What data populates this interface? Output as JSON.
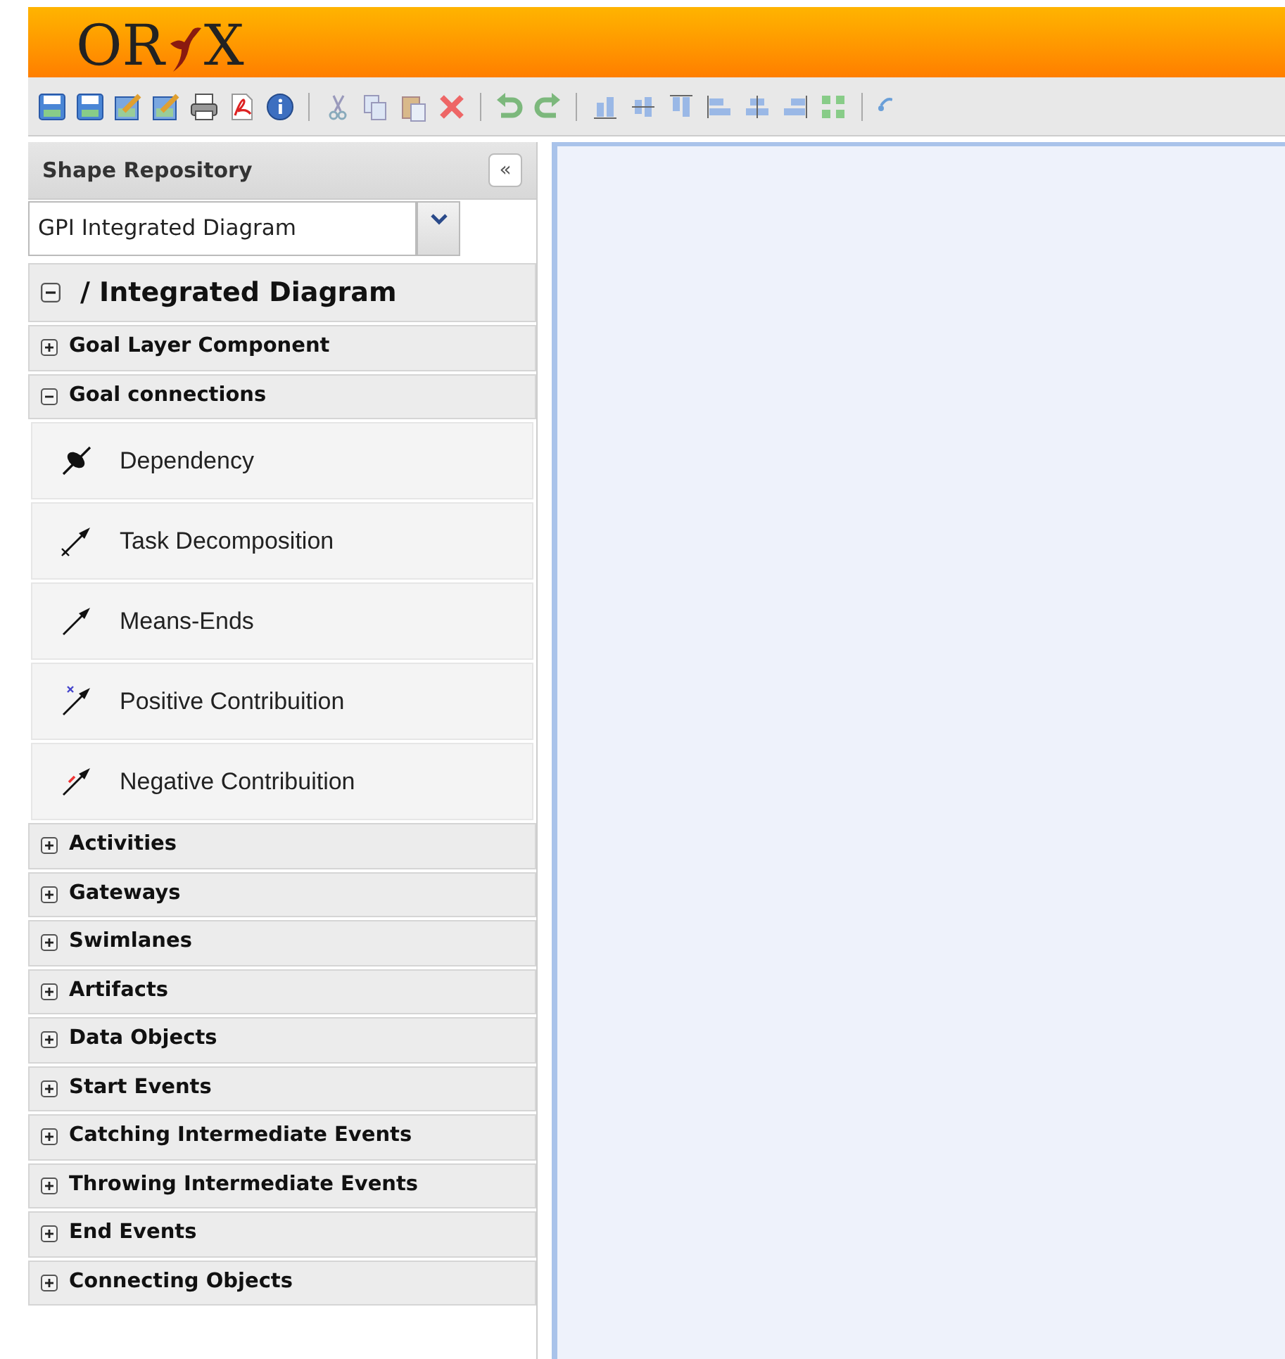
{
  "logo": {
    "left": "OR",
    "right": "X"
  },
  "sidebar": {
    "title": "Shape Repository",
    "collapse_button": "«",
    "stencil_select": {
      "value": "GPI Integrated Diagram"
    },
    "root": {
      "label": "/ Integrated Diagram",
      "expanded": true,
      "groups": [
        {
          "label": "Goal Layer Component",
          "expanded": false
        },
        {
          "label": "Goal connections",
          "expanded": true,
          "items": [
            {
              "label": "Dependency",
              "kind": "dependency"
            },
            {
              "label": "Task Decomposition",
              "kind": "decomposition"
            },
            {
              "label": "Means-Ends",
              "kind": "means-ends"
            },
            {
              "label": "Positive Contribuition",
              "kind": "positive"
            },
            {
              "label": "Negative Contribuition",
              "kind": "negative"
            }
          ]
        },
        {
          "label": "Activities",
          "expanded": false
        },
        {
          "label": "Gateways",
          "expanded": false
        },
        {
          "label": "Swimlanes",
          "expanded": false
        },
        {
          "label": "Artifacts",
          "expanded": false
        },
        {
          "label": "Data Objects",
          "expanded": false
        },
        {
          "label": "Start Events",
          "expanded": false
        },
        {
          "label": "Catching Intermediate Events",
          "expanded": false
        },
        {
          "label": "Throwing Intermediate Events",
          "expanded": false
        },
        {
          "label": "End Events",
          "expanded": false
        },
        {
          "label": "Connecting Objects",
          "expanded": false
        }
      ]
    }
  }
}
